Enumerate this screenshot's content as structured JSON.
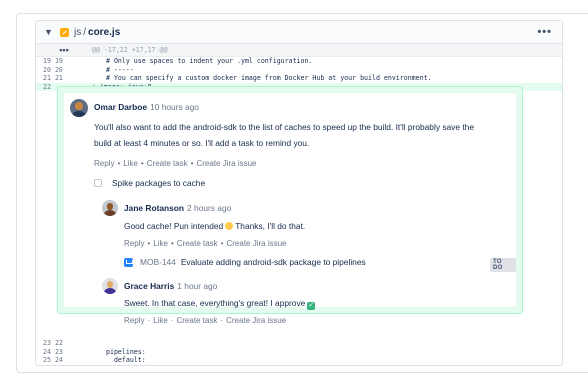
{
  "file": {
    "dir": "js",
    "separator": "/",
    "name": "core.js",
    "more_label": "•••"
  },
  "hunk": {
    "expand_label": "•••",
    "text": "@@ -17,22 +17,17 @@"
  },
  "lines": [
    {
      "old": "19",
      "new": "19",
      "text": "# Only use spaces to indent your .yml configuration."
    },
    {
      "old": "20",
      "new": "20",
      "text": "# -----"
    },
    {
      "old": "21",
      "new": "21",
      "text": "# You can specify a custom docker image from Docker Hub at your build environment."
    },
    {
      "old": "",
      "new": "22",
      "text": "+ image: java:8"
    }
  ],
  "bottom_lines": [
    {
      "old": "23",
      "new": "22",
      "text": ""
    },
    {
      "old": "24",
      "new": "23",
      "text": "pipelines:"
    },
    {
      "old": "25",
      "new": "24",
      "text": "  default:"
    }
  ],
  "comments": {
    "c1": {
      "author": "Omar Darboe",
      "time": "10 hours ago",
      "text_line1": "You'll also want to add the android-sdk to the list of caches to speed up the build. It'll probably save the",
      "text_line2": "build at least 4 minutes or so. I'll add a task to remind you.",
      "actions": [
        "Reply",
        "Like",
        "Create task",
        "Create Jira issue"
      ],
      "task": "Spike packages to cache"
    },
    "c2": {
      "author": "Jane Rotanson",
      "time": "2 hours ago",
      "text_before": "Good cache! Pun intended",
      "text_after": "Thanks, I'll do that.",
      "actions": [
        "Reply",
        "Like",
        "Create task",
        "Create Jira issue"
      ],
      "jira": {
        "key": "MOB-144",
        "summary": "Evaluate adding android-sdk package to pipelines",
        "status": "TO DO"
      }
    },
    "c3": {
      "author": "Grace Harris",
      "time": "1 hour ago",
      "text": "Sweet. In that case, everything's great! I approve",
      "actions": [
        "Reply",
        "Like",
        "Create task",
        "Create Jira issue"
      ]
    }
  },
  "separators": {
    "dot": "•",
    "mid": "·"
  },
  "colors": {
    "added_bg": "#e3fcef",
    "thread_border": "#abf5d1",
    "jira_blue": "#2684ff",
    "file_icon": "#ffab00"
  }
}
